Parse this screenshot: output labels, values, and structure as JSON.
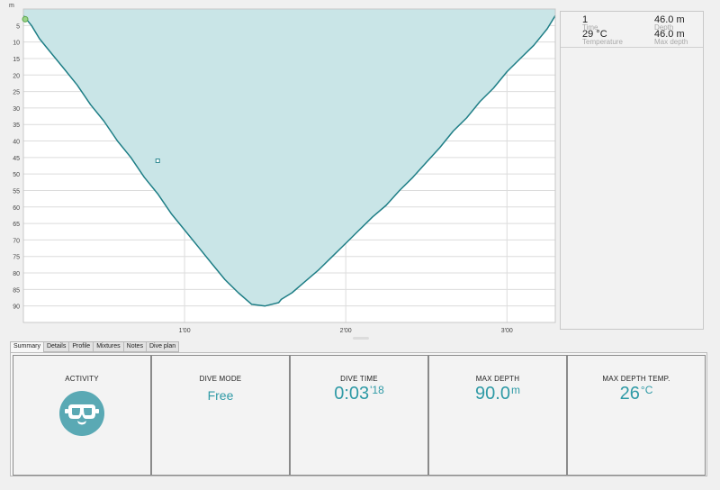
{
  "profile": {
    "depth_unit": "m",
    "y_ticks": [
      "5",
      "10",
      "15",
      "20",
      "25",
      "30",
      "35",
      "40",
      "45",
      "50",
      "55",
      "60",
      "65",
      "70",
      "75",
      "80",
      "85",
      "90"
    ],
    "x_ticks": [
      "1'00",
      "2'00",
      "3'00"
    ],
    "colors": {
      "fill": "#c9e5e7",
      "line": "#1e7e86",
      "grid": "#dcdcdc",
      "marker": "#2f8a92"
    }
  },
  "chart_data": {
    "type": "area",
    "ylabel": "m",
    "y_reversed": true,
    "ylim": [
      0,
      95
    ],
    "xlim_seconds": [
      0,
      198
    ],
    "x_tick_labels": [
      "1'00",
      "2'00",
      "3'00"
    ],
    "x_tick_seconds": [
      60,
      120,
      180
    ],
    "series": [
      {
        "x": [
          0,
          3,
          6,
          10,
          15,
          20,
          25,
          30,
          35,
          40,
          45,
          50,
          55,
          60,
          65,
          70,
          75,
          80,
          85,
          90,
          95,
          96,
          100,
          105,
          110,
          115,
          120,
          125,
          130,
          135,
          140,
          145,
          150,
          155,
          160,
          165,
          170,
          175,
          180,
          185,
          190,
          195,
          198
        ],
        "y": [
          2,
          5,
          9,
          13,
          18,
          23,
          29,
          34,
          40,
          45,
          51,
          56,
          62,
          67,
          72,
          77,
          82,
          86,
          89.5,
          90,
          89,
          88,
          86,
          82.5,
          79,
          75,
          71,
          67,
          63,
          59.5,
          55,
          51,
          46.5,
          42,
          37,
          33,
          28,
          24,
          19,
          15,
          11,
          6,
          2
        ]
      }
    ],
    "marker": {
      "x": 50,
      "y": 46
    }
  },
  "side_panel": {
    "index": "1",
    "max_depth_top": "46.0 m",
    "time_label": "Time",
    "depth_label": "Depth",
    "temperature": "29 °C",
    "temperature_label": "Temperature",
    "max_depth": "46.0 m",
    "max_depth_label": "Max depth"
  },
  "tabs": [
    {
      "label": "Summary",
      "active": true
    },
    {
      "label": "Details"
    },
    {
      "label": "Profile"
    },
    {
      "label": "Mixtures"
    },
    {
      "label": "Notes"
    },
    {
      "label": "Dive plan"
    }
  ],
  "summary": {
    "activity": {
      "label": "ACTIVITY",
      "icon": "diving-mask-icon"
    },
    "dive_mode": {
      "label": "DIVE MODE",
      "value": "Free"
    },
    "dive_time": {
      "label": "DIVE TIME",
      "value": "0:03",
      "suffix": "'18"
    },
    "max_depth": {
      "label": "MAX DEPTH",
      "value": "90.0",
      "unit": "m"
    },
    "max_depth_temp": {
      "label": "MAX DEPTH TEMP.",
      "value": "26",
      "unit": "°C"
    }
  }
}
